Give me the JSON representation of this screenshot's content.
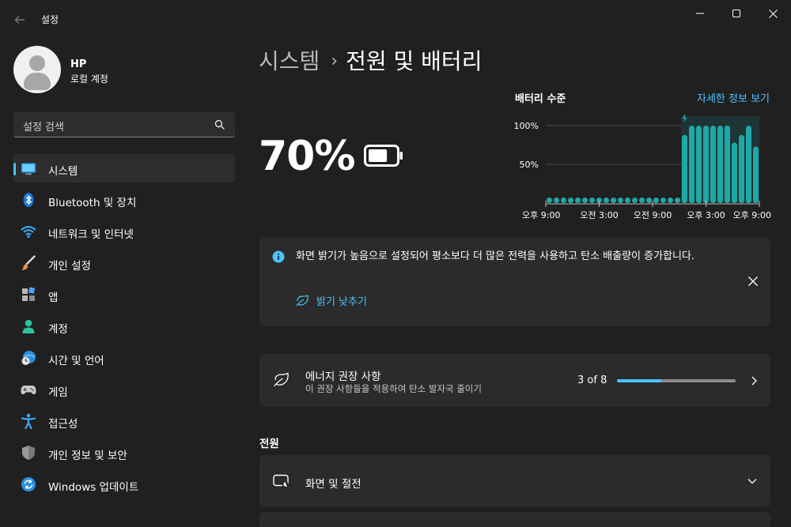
{
  "window": {
    "title": "설정"
  },
  "profile": {
    "name": "HP",
    "account_type": "로컬 계정"
  },
  "search": {
    "placeholder": "설정 검색"
  },
  "sidebar": {
    "items": [
      {
        "label": "시스템",
        "icon": "system-icon",
        "active": true
      },
      {
        "label": "Bluetooth 및 장치",
        "icon": "bluetooth-icon"
      },
      {
        "label": "네트워크 및 인터넷",
        "icon": "wifi-icon"
      },
      {
        "label": "개인 설정",
        "icon": "brush-icon"
      },
      {
        "label": "앱",
        "icon": "apps-icon"
      },
      {
        "label": "계정",
        "icon": "account-icon"
      },
      {
        "label": "시간 및 언어",
        "icon": "time-language-icon"
      },
      {
        "label": "게임",
        "icon": "gamepad-icon"
      },
      {
        "label": "접근성",
        "icon": "accessibility-icon"
      },
      {
        "label": "개인 정보 및 보안",
        "icon": "shield-icon"
      },
      {
        "label": "Windows 업데이트",
        "icon": "update-icon"
      }
    ]
  },
  "breadcrumb": {
    "parent": "시스템",
    "separator": "›",
    "current": "전원 및 배터리"
  },
  "battery": {
    "percent_label": "70%",
    "level": 0.7
  },
  "battery_chart": {
    "title": "배터리 수준",
    "link": "자세한 정보 보기"
  },
  "chart_data": {
    "type": "bar",
    "title": "배터리 수준",
    "y_tick_labels": [
      "100%",
      "50%"
    ],
    "ylim": [
      0,
      100
    ],
    "x_tick_labels": [
      "오후 9:00",
      "오전 3:00",
      "오전 9:00",
      "오후 3:00",
      "오후 9:00"
    ],
    "charging_start_index": 19,
    "values": [
      5,
      5,
      5,
      5,
      5,
      5,
      5,
      5,
      5,
      5,
      5,
      5,
      5,
      5,
      5,
      5,
      5,
      5,
      5,
      88,
      100,
      100,
      100,
      100,
      100,
      100,
      78,
      88,
      100,
      73
    ],
    "grid": true,
    "colors": {
      "bar": "#1fa8a8",
      "bar_charging_bg": "#1d3535",
      "grid": "#4a4a4a"
    }
  },
  "info_banner": {
    "message": "화면 밝기가 높음으로 설정되어 평소보다 더 많은 전력을 사용하고 탄소 배출량이 증가합니다.",
    "action": "밝기 낮추기"
  },
  "energy": {
    "title": "에너지 권장 사항",
    "subtitle": "이 권장 사항들을 적용하여 탄소 발자국 줄이기",
    "count_label": "3 of 8",
    "progress": 0.375
  },
  "power_section": {
    "title": "전원",
    "display_item": "화면 및 절전"
  },
  "colors": {
    "accent": "#4cc2ff",
    "background": "#202020",
    "card": "#2b2b2b"
  }
}
